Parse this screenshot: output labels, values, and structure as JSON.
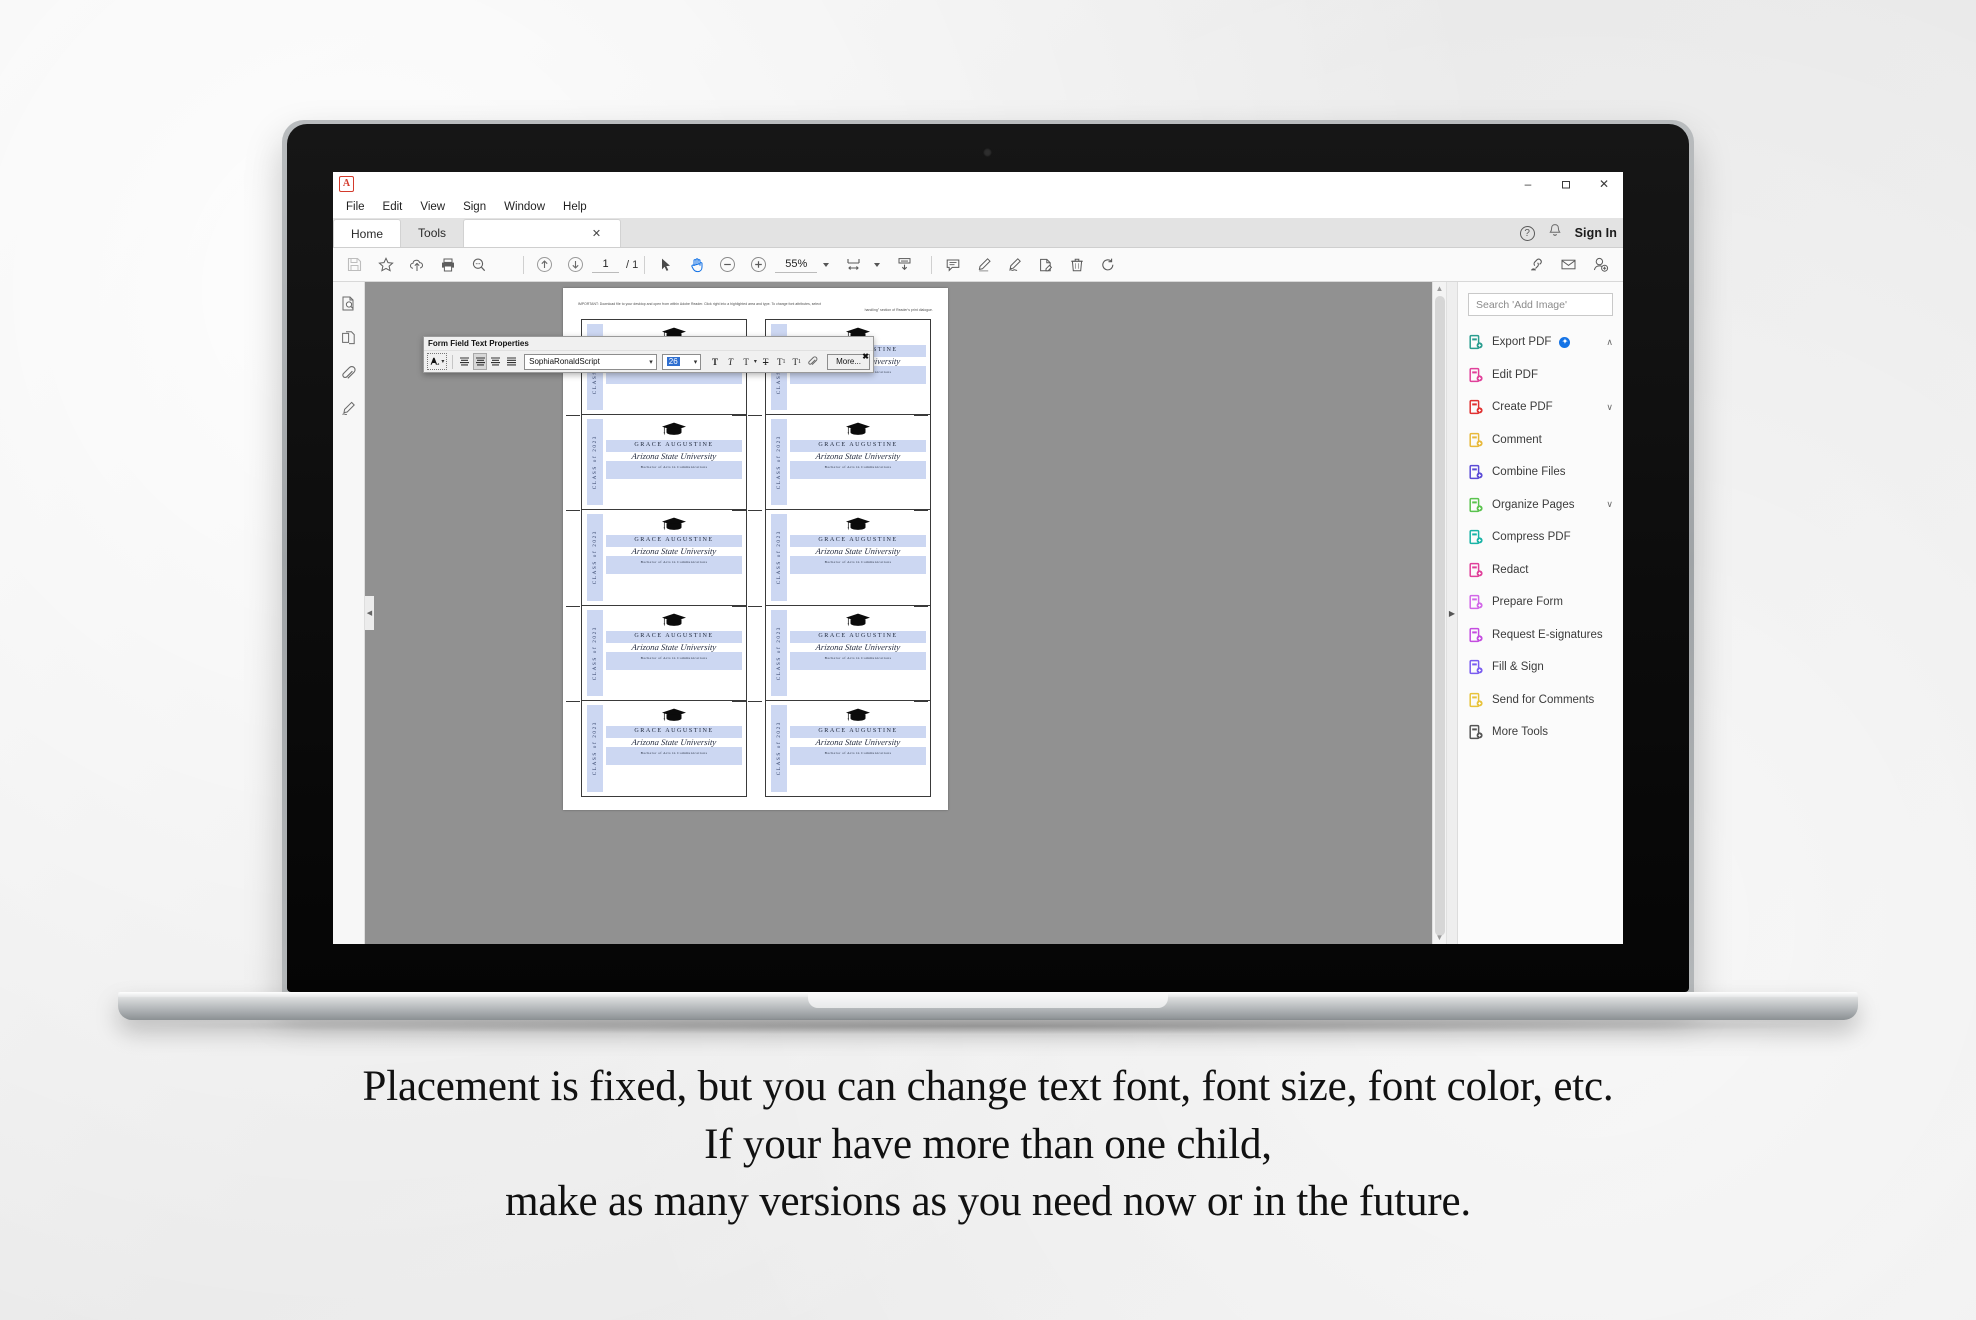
{
  "window": {
    "app_logo": "acrobat-logo",
    "menus": [
      "File",
      "Edit",
      "View",
      "Sign",
      "Window",
      "Help"
    ],
    "controls": {
      "minimize": "–",
      "maximize": "❐",
      "close": "✕"
    }
  },
  "tabs": {
    "home": "Home",
    "tools": "Tools",
    "document_close": "✕",
    "help": "?",
    "bell": "bell-icon",
    "sign_in": "Sign In"
  },
  "toolbar": {
    "save": "save-icon",
    "star": "star-icon",
    "upload": "cloud-upload-icon",
    "print": "print-icon",
    "search": "search-icon",
    "prev_page": "↑",
    "next_page": "↓",
    "page_current": "1",
    "page_total": "/ 1",
    "select_tool": "cursor-icon",
    "hand_tool": "hand-icon",
    "zoom_out": "−",
    "zoom_in": "+",
    "zoom_level": "55%",
    "fit_width": "fit-width-icon",
    "scroll_mode": "scroll-mode-icon",
    "comment": "comment-icon",
    "highlight": "highlight-pen-icon",
    "sign": "sign-icon",
    "stamp": "stamp-icon",
    "delete": "trash-icon",
    "rotate": "rotate-icon",
    "share_link": "share-link-icon",
    "email": "email-icon",
    "add_person": "add-person-icon"
  },
  "left_rail": [
    "page-thumbnails-icon",
    "pages-copy-icon",
    "attachments-icon",
    "signature-icon"
  ],
  "dialog": {
    "title": "Form Field Text Properties",
    "text_color": "text-color-icon",
    "align_left": "≡",
    "align_center": "≡",
    "align_right": "≡",
    "align_justify": "≡",
    "font_family": "SophiaRonaldScript",
    "font_size": "26",
    "bold": "T",
    "italic": "T",
    "color_menu": "T",
    "strikethrough": "T",
    "superscript": "T",
    "subscript": "T",
    "attach": "paperclip-icon",
    "more_button": "More...",
    "close": "✖"
  },
  "pdf": {
    "note_line1": "IMPORTANT: Download file to your desktop and open from within Adobe Reader. Click right into a highlighted area and type. To change font attributes, select",
    "note_line2": "handling\" section of Reader's print dialogue.",
    "card": {
      "class_of": "CLASS of 2023",
      "name": "GRACE AUGUSTINE",
      "university": "Arizona State University",
      "degree": "Bachelor of Arts in Communications",
      "cap_icon": "graduation-cap-icon"
    },
    "band_color": "#ccd7f2",
    "selection_color": "#8fb9c9",
    "rows": 5,
    "columns": 2
  },
  "right_panel": {
    "search_placeholder": "Search 'Add Image'",
    "tools": [
      {
        "label": "Export PDF",
        "icon": "export-pdf-icon",
        "color": "#2a9d8f",
        "badge": "✦",
        "chevron": "∧"
      },
      {
        "label": "Edit PDF",
        "icon": "edit-pdf-icon",
        "color": "#e0409a",
        "badge": "",
        "chevron": ""
      },
      {
        "label": "Create PDF",
        "icon": "create-pdf-icon",
        "color": "#e03131",
        "badge": "",
        "chevron": "∨"
      },
      {
        "label": "Comment",
        "icon": "comment-icon",
        "color": "#e8b93b",
        "badge": "",
        "chevron": ""
      },
      {
        "label": "Combine Files",
        "icon": "combine-files-icon",
        "color": "#5b4bd6",
        "badge": "",
        "chevron": ""
      },
      {
        "label": "Organize Pages",
        "icon": "organize-pages-icon",
        "color": "#5ac34e",
        "badge": "",
        "chevron": "∨"
      },
      {
        "label": "Compress PDF",
        "icon": "compress-pdf-icon",
        "color": "#19b3a6",
        "badge": "",
        "chevron": ""
      },
      {
        "label": "Redact",
        "icon": "redact-icon",
        "color": "#e0409a",
        "badge": "",
        "chevron": ""
      },
      {
        "label": "Prepare Form",
        "icon": "prepare-form-icon",
        "color": "#d267e8",
        "badge": "",
        "chevron": ""
      },
      {
        "label": "Request E-signatures",
        "icon": "request-esignatures-icon",
        "color": "#c44ce0",
        "badge": "",
        "chevron": ""
      },
      {
        "label": "Fill & Sign",
        "icon": "fill-sign-icon",
        "color": "#7a5cf0",
        "badge": "",
        "chevron": ""
      },
      {
        "label": "Send for Comments",
        "icon": "send-for-comments-icon",
        "color": "#e8c33b",
        "badge": "",
        "chevron": ""
      },
      {
        "label": "More Tools",
        "icon": "more-tools-icon",
        "color": "#555555",
        "badge": "",
        "chevron": ""
      }
    ]
  },
  "caption": {
    "line1": "Placement is fixed, but you can change text font, font size, font color, etc.",
    "line2": "If your have more than one child,",
    "line3": "make as many versions as you need now or in the future."
  }
}
